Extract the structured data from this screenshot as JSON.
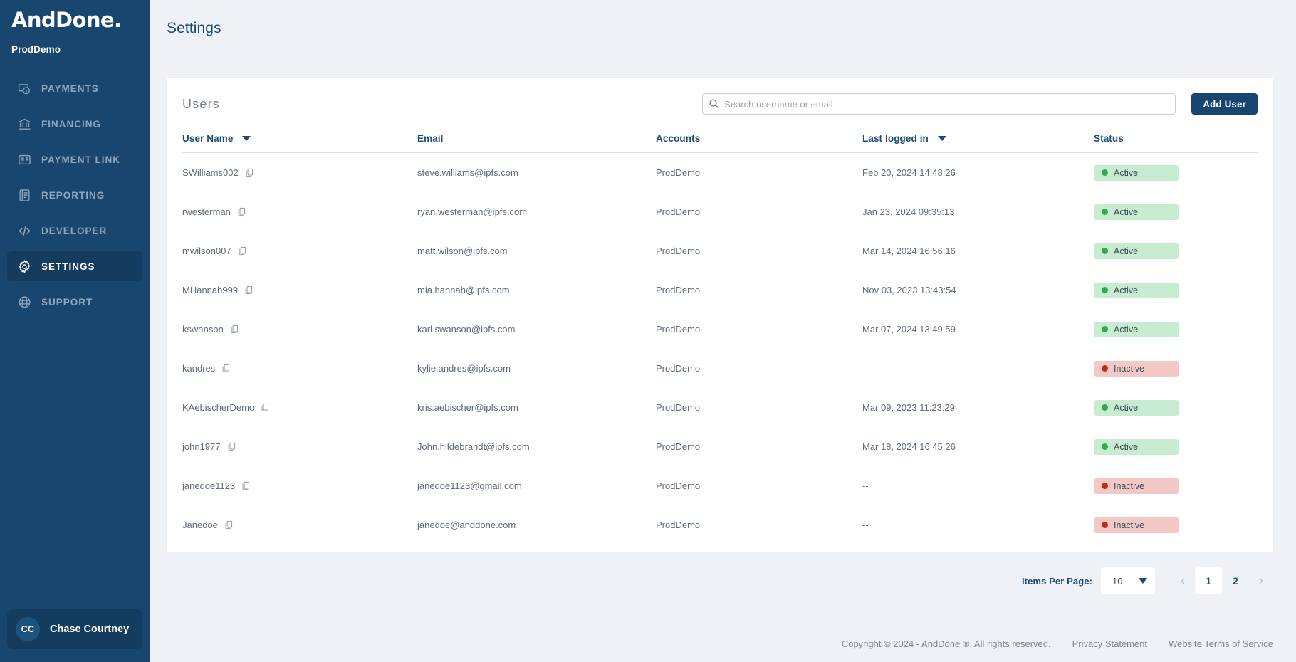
{
  "sidebar": {
    "brand": "AndDone",
    "brand_suffix": ".",
    "account_name": "ProdDemo",
    "items": [
      {
        "label": "PAYMENTS",
        "icon": "money-bill-icon",
        "active": false
      },
      {
        "label": "FINANCING",
        "icon": "bank-icon",
        "active": false
      },
      {
        "label": "PAYMENT LINK",
        "icon": "payment-link-icon",
        "active": false
      },
      {
        "label": "REPORTING",
        "icon": "report-icon",
        "active": false
      },
      {
        "label": "DEVELOPER",
        "icon": "code-icon",
        "active": false
      },
      {
        "label": "SETTINGS",
        "icon": "gear-icon",
        "active": true
      },
      {
        "label": "SUPPORT",
        "icon": "globe-icon",
        "active": false
      }
    ],
    "profile": {
      "initials": "CC",
      "name": "Chase Courtney"
    }
  },
  "header": {
    "title": "Settings"
  },
  "card": {
    "title": "Users",
    "search": {
      "placeholder": "Search username or email",
      "value": "",
      "icon": "search-icon"
    },
    "add_user_label": "Add User"
  },
  "table": {
    "columns": [
      {
        "label": "User Name",
        "sortable": true
      },
      {
        "label": "Email",
        "sortable": false
      },
      {
        "label": "Accounts",
        "sortable": false
      },
      {
        "label": "Last logged in",
        "sortable": true
      },
      {
        "label": "Status",
        "sortable": false
      }
    ],
    "rows": [
      {
        "user": "SWilliams002",
        "email": "steve.williams@ipfs.com",
        "account": "ProdDemo",
        "last_login": "Feb 20, 2024 14:48:26",
        "status": "Active"
      },
      {
        "user": "rwesterman",
        "email": "ryan.westerman@ipfs.com",
        "account": "ProdDemo",
        "last_login": "Jan 23, 2024 09:35:13",
        "status": "Active"
      },
      {
        "user": "mwilson007",
        "email": "matt.wilson@ipfs.com",
        "account": "ProdDemo",
        "last_login": "Mar 14, 2024 16:56:16",
        "status": "Active"
      },
      {
        "user": "MHannah999",
        "email": "mia.hannah@ipfs.com",
        "account": "ProdDemo",
        "last_login": "Nov 03, 2023 13:43:54",
        "status": "Active"
      },
      {
        "user": "kswanson",
        "email": "karl.swanson@ipfs.com",
        "account": "ProdDemo",
        "last_login": "Mar 07, 2024 13:49:59",
        "status": "Active"
      },
      {
        "user": "kandres",
        "email": "kylie.andres@ipfs.com",
        "account": "ProdDemo",
        "last_login": "--",
        "status": "Inactive"
      },
      {
        "user": "KAebischerDemo",
        "email": "kris.aebischer@ipfs.com",
        "account": "ProdDemo",
        "last_login": "Mar 09, 2023 11:23:29",
        "status": "Active"
      },
      {
        "user": "john1977",
        "email": "John.hildebrandt@ipfs.com",
        "account": "ProdDemo",
        "last_login": "Mar 18, 2024 16:45:26",
        "status": "Active"
      },
      {
        "user": "janedoe1123",
        "email": "janedoe1123@gmail.com",
        "account": "ProdDemo",
        "last_login": "--",
        "status": "Inactive"
      },
      {
        "user": "Janedoe",
        "email": "janedoe@anddone.com",
        "account": "ProdDemo",
        "last_login": "--",
        "status": "Inactive"
      }
    ]
  },
  "pagination": {
    "items_per_page_label": "Items Per Page:",
    "items_per_page_value": "10",
    "prev_glyph": "‹",
    "next_glyph": "›",
    "pages": [
      "1",
      "2"
    ],
    "current_page": "1"
  },
  "footer": {
    "copyright": "Copyright © 2024 - AndDone ®. All rights reserved.",
    "privacy": "Privacy Statement",
    "terms": "Website Terms of Service"
  },
  "colors": {
    "sidebar_bg": "#18466e",
    "sidebar_active": "#143c5e",
    "accent": "#184470",
    "page_bg": "#eef1f6",
    "status_active_bg": "#c8ecd0",
    "status_active_dot": "#2faa4d",
    "status_inactive_bg": "#f2c9c4",
    "status_inactive_dot": "#c42b1c"
  }
}
